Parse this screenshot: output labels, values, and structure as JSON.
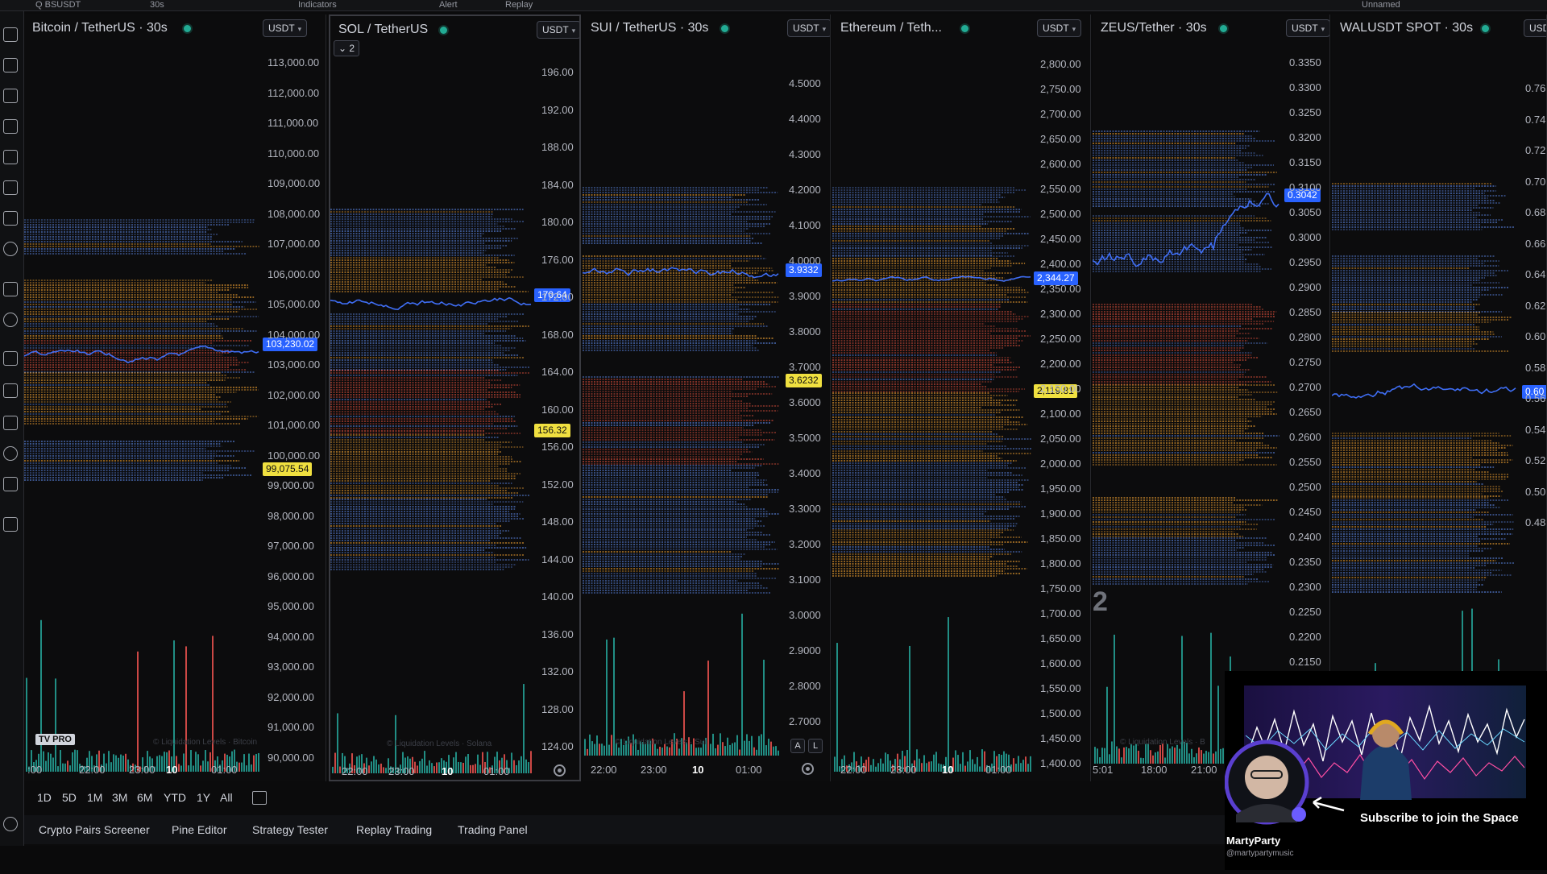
{
  "topbar": {
    "search_label": "Q BSUSDT",
    "interval": "30s",
    "indicators_label": "Indicators",
    "alert_label": "Alert",
    "replay_label": "Replay",
    "layout_label": "Unnamed"
  },
  "panes": [
    {
      "title": "Bitcoin / TetherUS · 30s",
      "unit": "USDT",
      "price_ticks": [
        "113,000.00",
        "112,000.00",
        "111,000.00",
        "110,000.00",
        "109,000.00",
        "108,000.00",
        "107,000.00",
        "106,000.00",
        "105,000.00",
        "104,000.00",
        "103,000.00",
        "102,000.00",
        "101,000.00",
        "100,000.00",
        "99,000.00",
        "98,000.00",
        "97,000.00",
        "96,000.00",
        "95,000.00",
        "94,000.00",
        "93,000.00",
        "92,000.00",
        "91,000.00",
        "90,000.00"
      ],
      "price_tag_blue": "103,230.02",
      "price_tag_yellow": "99,075.54",
      "time_ticks": [
        ":00",
        "22:00",
        "23:00",
        "10",
        "01:00"
      ],
      "logo_text": "TV PRO",
      "watermark": "© Liquidation Levels · Bitcoin"
    },
    {
      "title": "SOL / TetherUS",
      "unit": "USDT",
      "collapse_label": "2",
      "price_ticks": [
        "196.00",
        "192.00",
        "188.00",
        "184.00",
        "180.00",
        "176.00",
        "172.00",
        "168.00",
        "164.00",
        "160.00",
        "156.00",
        "152.00",
        "148.00",
        "144.00",
        "140.00",
        "136.00",
        "132.00",
        "128.00",
        "124.00"
      ],
      "price_tag_blue": "170.64",
      "price_tag_yellow": "156.32",
      "time_ticks": [
        "22:00",
        "23:00",
        "10",
        "01:00"
      ],
      "watermark": "© Liquidation Levels · Solana"
    },
    {
      "title": "SUI / TetherUS · 30s",
      "unit": "USDT",
      "price_ticks": [
        "4.5000",
        "4.4000",
        "4.3000",
        "4.2000",
        "4.1000",
        "4.0000",
        "3.9000",
        "3.8000",
        "3.7000",
        "3.6000",
        "3.5000",
        "3.4000",
        "3.3000",
        "3.2000",
        "3.1000",
        "3.0000",
        "2.9000",
        "2.8000",
        "2.7000"
      ],
      "price_tag_blue": "3.9332",
      "price_tag_yellow": "3.6232",
      "time_ticks": [
        "22:00",
        "23:00",
        "10",
        "01:00"
      ],
      "btn_a": "A",
      "btn_l": "L",
      "watermark": "© Liquidation Levels · Sui"
    },
    {
      "title": "Ethereum / Teth...",
      "unit": "USDT",
      "price_ticks": [
        "2,800.00",
        "2,750.00",
        "2,700.00",
        "2,650.00",
        "2,600.00",
        "2,550.00",
        "2,500.00",
        "2,450.00",
        "2,400.00",
        "2,350.00",
        "2,300.00",
        "2,250.00",
        "2,200.00",
        "2,150.00",
        "2,100.00",
        "2,050.00",
        "2,000.00",
        "1,950.00",
        "1,900.00",
        "1,850.00",
        "1,800.00",
        "1,750.00",
        "1,700.00",
        "1,650.00",
        "1,600.00",
        "1,550.00",
        "1,500.00",
        "1,450.00",
        "1,400.00"
      ],
      "price_tag_blue": "2,344.27",
      "price_tag_yellow": "2,119.81",
      "time_ticks": [
        "22:00",
        "23:00",
        "10",
        "01:00"
      ]
    },
    {
      "title": "ZEUS/Tether · 30s",
      "unit": "USDT",
      "price_ticks": [
        "0.3350",
        "0.3300",
        "0.3250",
        "0.3200",
        "0.3150",
        "0.3100",
        "0.3050",
        "0.3000",
        "0.2950",
        "0.2900",
        "0.2850",
        "0.2800",
        "0.2750",
        "0.2700",
        "0.2650",
        "0.2600",
        "0.2550",
        "0.2500",
        "0.2450",
        "0.2400",
        "0.2350",
        "0.2300",
        "0.2250",
        "0.2200",
        "0.2150",
        "0.2100"
      ],
      "price_tag_blue": "0.3042",
      "time_ticks": [
        "5:01",
        "18:00",
        "21:00"
      ],
      "big_digit": "2",
      "watermark": "© Liquidation Levels · B"
    },
    {
      "title": "WALUSDT SPOT · 30s",
      "unit": "USDT",
      "price_ticks": [
        "0.76",
        "0.74",
        "0.72",
        "0.70",
        "0.68",
        "0.66",
        "0.64",
        "0.62",
        "0.60",
        "0.58",
        "0.56",
        "0.54",
        "0.52",
        "0.50",
        "0.48"
      ],
      "price_tag_blue": "0.60"
    }
  ],
  "timeframes": [
    "1D",
    "5D",
    "1M",
    "3M",
    "6M",
    "YTD",
    "1Y",
    "All"
  ],
  "bottom_tabs": [
    "Crypto Pairs Screener",
    "Pine Editor",
    "Strategy Tester",
    "Replay Trading",
    "Trading Panel"
  ],
  "overlay": {
    "cta": "Subscribe to join the Space",
    "name": "MartyParty",
    "handle": "@martypartymusic"
  },
  "colors": {
    "accent_blue": "#2962ff",
    "price_line": "#3f6ef5",
    "level_orange": "#f0a030",
    "level_red": "#e0503c",
    "level_blue": "#5b86e5",
    "volume_green": "#26a69a",
    "volume_red": "#ef5350",
    "tag_yellow": "#f0e040"
  }
}
